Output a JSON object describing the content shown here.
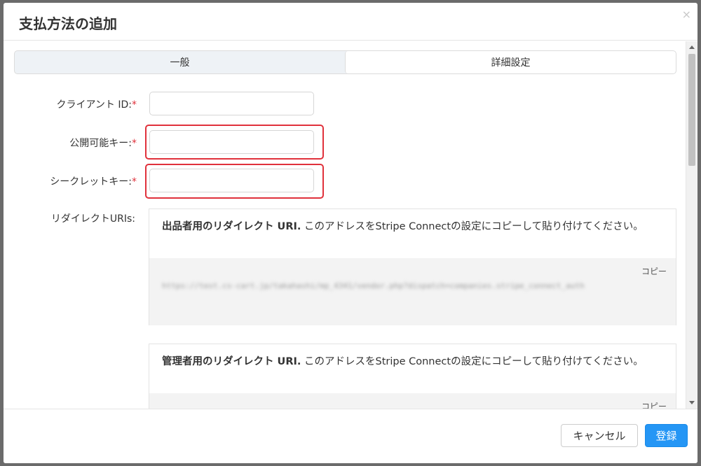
{
  "dialog": {
    "title": "支払方法の追加",
    "close_symbol": "×"
  },
  "tabs": [
    {
      "label": "一般",
      "active": false
    },
    {
      "label": "詳細設定",
      "active": true
    }
  ],
  "form": {
    "client_id_label": "クライアント ID:",
    "publishable_key_label": "公開可能キー:",
    "secret_key_label": "シークレットキー:",
    "required_mark": "*",
    "client_id_value": "",
    "publishable_key_value": "",
    "secret_key_value": "",
    "redirect_uris_label": "リダイレクトURIs:"
  },
  "redirect_uris": [
    {
      "title": "出品者用のリダイレクト URI.",
      "description": " このアドレスをStripe Connectの設定にコピーして貼り付けてください。",
      "copy_label": "コピー",
      "value": "https://test.cs-cart.jp/takahashi/mp_4341/vendor.php?dispatch=companies.stripe_connect_auth"
    },
    {
      "title": "管理者用のリダイレクト URI.",
      "description": " このアドレスをStripe Connectの設定にコピーして貼り付けてください。",
      "copy_label": "コピー",
      "value": ""
    }
  ],
  "footer": {
    "cancel_label": "キャンセル",
    "submit_label": "登録"
  },
  "colors": {
    "accent": "#2596f5",
    "required": "#e0313b",
    "highlight_border": "#e0313b"
  }
}
